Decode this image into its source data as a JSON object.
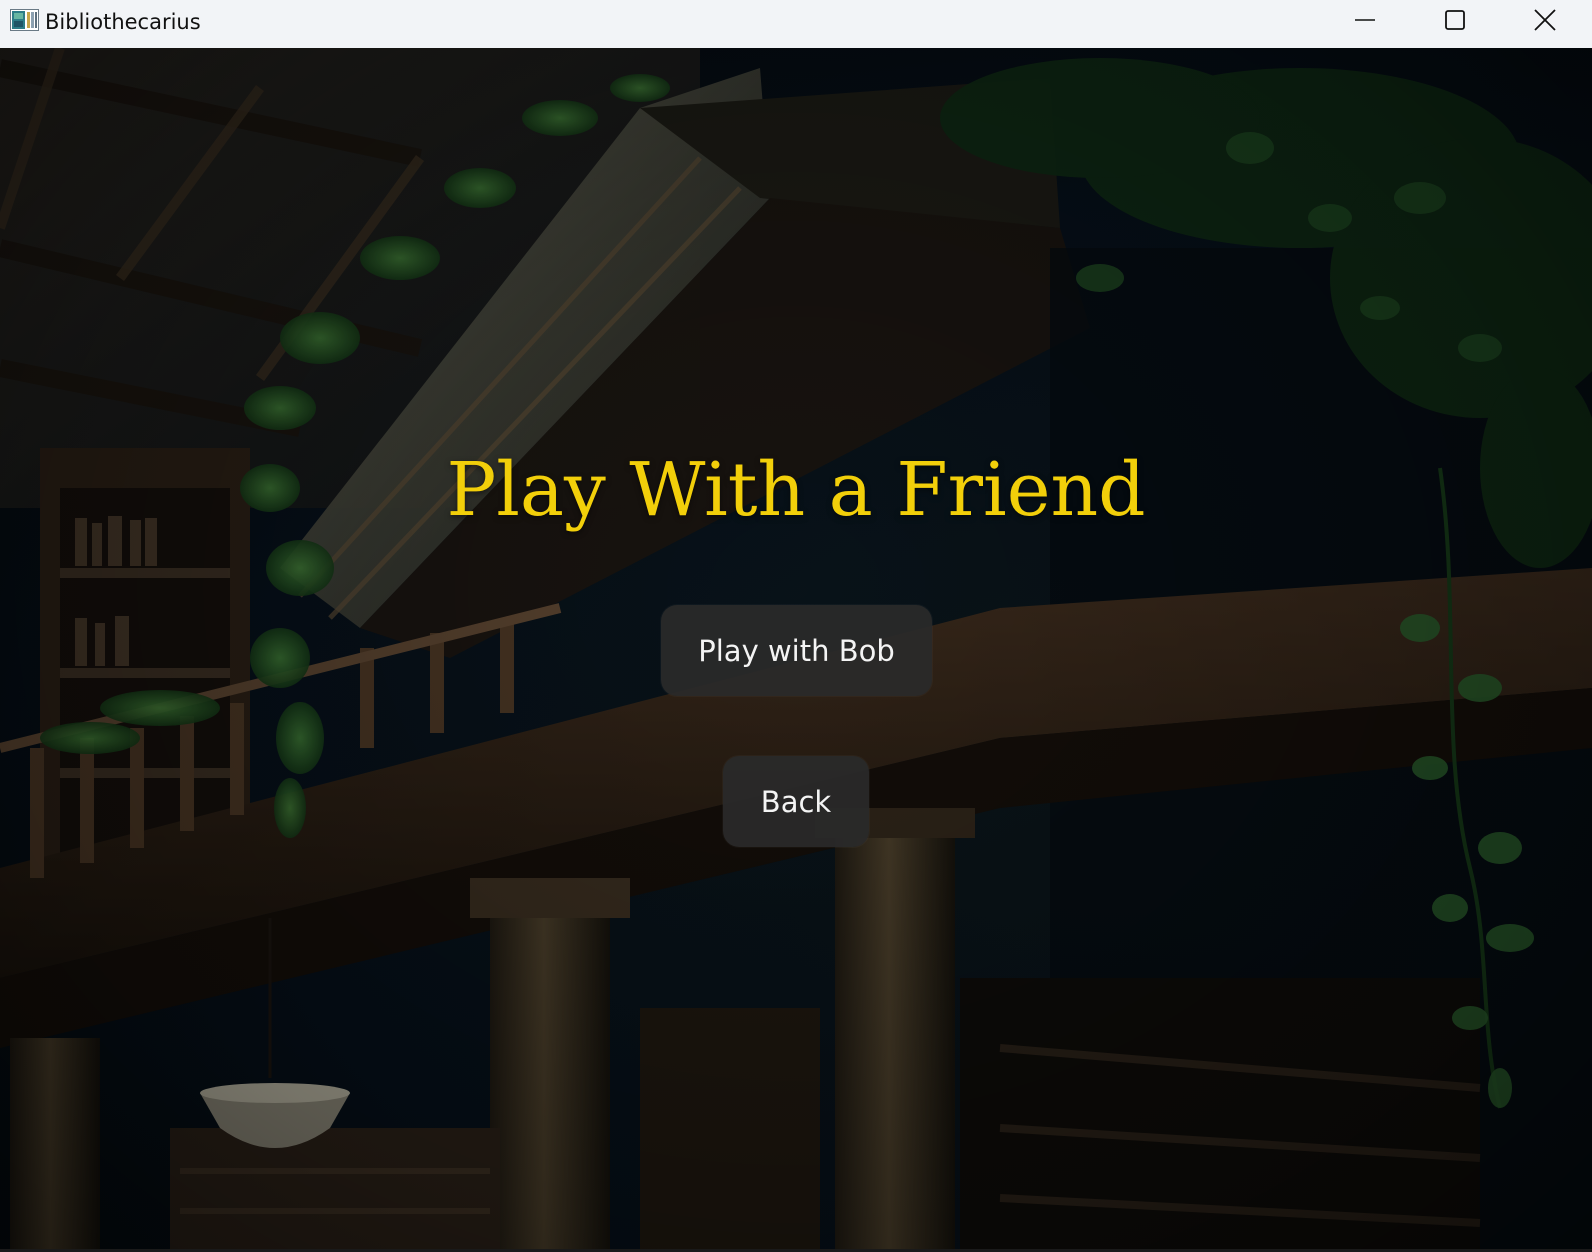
{
  "window": {
    "title": "Bibliothecarius",
    "icon": "app-icon",
    "controls": {
      "minimize": "minimize-icon",
      "maximize": "maximize-icon",
      "close": "close-icon"
    }
  },
  "menu": {
    "title": "Play With a Friend",
    "title_color": "#f2cf0a",
    "buttons": {
      "play_with_bob": "Play with Bob",
      "back": "Back"
    }
  },
  "colors": {
    "titlebar": "#f2f4f7",
    "button_bg": "#2a2a2a",
    "button_text": "#f4f4f4"
  }
}
